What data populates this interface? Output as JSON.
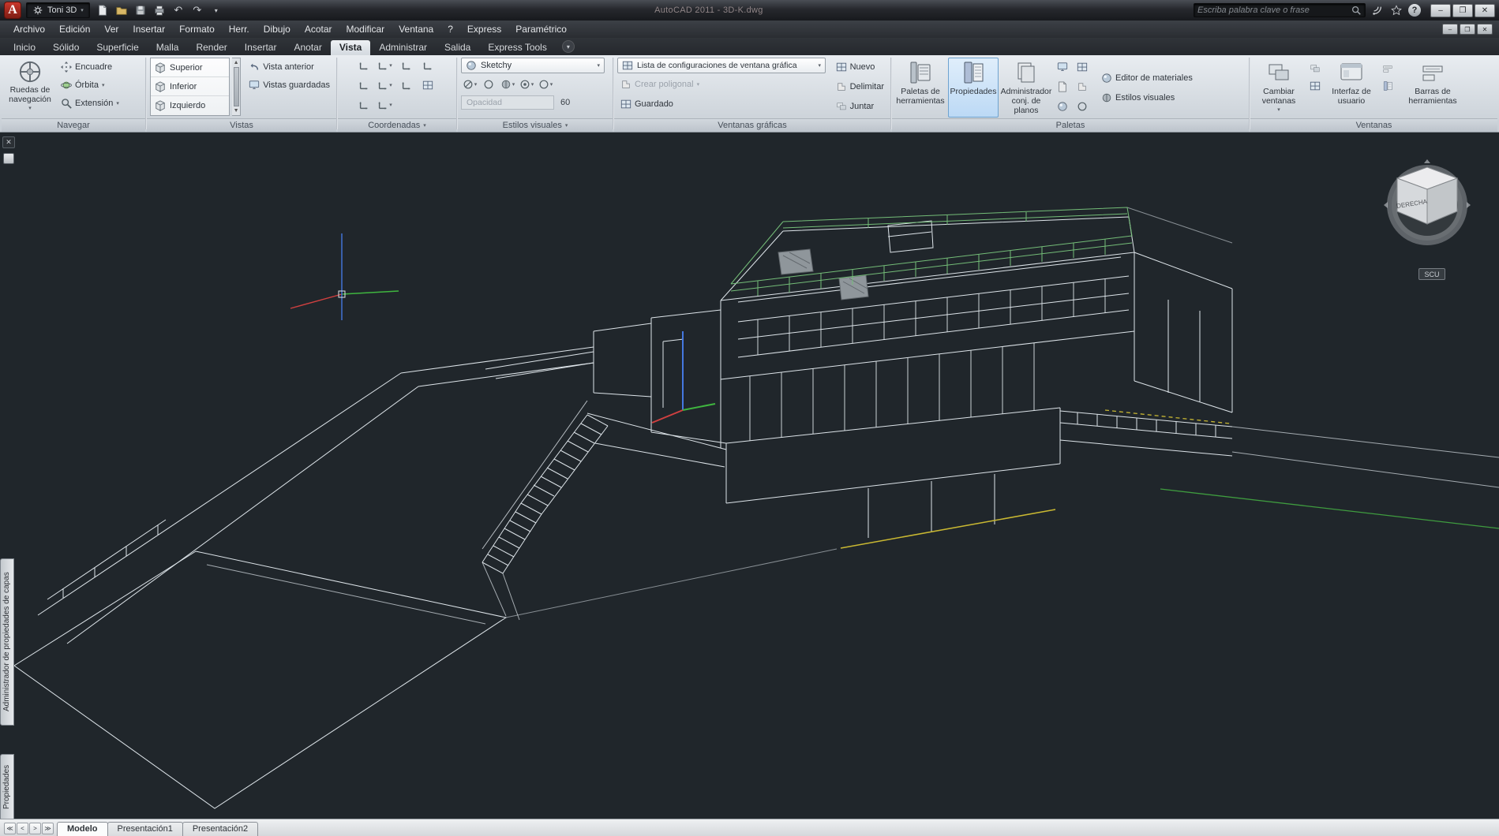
{
  "titlebar": {
    "logo_letter": "A",
    "workspace": "Toni 3D",
    "title": "AutoCAD 2011 - 3D-K.dwg",
    "search_placeholder": "Escriba palabra clave o frase"
  },
  "window": {
    "minimize": "–",
    "restore": "❐",
    "close": "✕"
  },
  "menubar": {
    "items": [
      "Archivo",
      "Edición",
      "Ver",
      "Insertar",
      "Formato",
      "Herr.",
      "Dibujo",
      "Acotar",
      "Modificar",
      "Ventana",
      "?",
      "Express",
      "Paramétrico"
    ]
  },
  "ribbon": {
    "tabs": [
      "Inicio",
      "Sólido",
      "Superficie",
      "Malla",
      "Render",
      "Insertar",
      "Anotar",
      "Vista",
      "Administrar",
      "Salida",
      "Express Tools"
    ],
    "active_tab": "Vista",
    "navegar": {
      "label": "Navegar",
      "wheel": "Ruedas de navegación",
      "encuadre": "Encuadre",
      "orbita": "Órbita",
      "extension": "Extensión"
    },
    "vistas": {
      "label": "Vistas",
      "items": [
        "Superior",
        "Inferior",
        "Izquierdo"
      ],
      "anterior": "Vista anterior",
      "guardadas": "Vistas guardadas"
    },
    "coordenadas": {
      "label": "Coordenadas"
    },
    "estilos": {
      "label": "Estilos visuales",
      "actual": "Sketchy",
      "opacidad": "Opacidad",
      "opacidad_valor": "60"
    },
    "vgraficas": {
      "label": "Ventanas gráficas",
      "lista": "Lista de configuraciones de ventana gráfica",
      "crear": "Crear poligonal",
      "guardado": "Guardado",
      "nuevo": "Nuevo",
      "delimitar": "Delimitar",
      "juntar": "Juntar"
    },
    "paletas": {
      "label": "Paletas",
      "herramientas": "Paletas de herramientas",
      "propiedades": "Propiedades",
      "admin": "Administrador conj. de planos",
      "editor": "Editor de materiales",
      "estilos": "Estilos visuales"
    },
    "ventanas": {
      "label": "Ventanas",
      "cambiar": "Cambiar ventanas",
      "interfaz": "Interfaz de usuario",
      "barras": "Barras de herramientas"
    }
  },
  "viewport": {
    "viewcube_face": "DERECHA",
    "scu_badge": "SCU"
  },
  "side_tabs": {
    "capas": "Administrador de propiedades de capas",
    "propiedades": "Propiedades"
  },
  "statusbar": {
    "tabs": [
      "Modelo",
      "Presentación1",
      "Presentación2"
    ],
    "active_tab": "Modelo"
  },
  "colors": {
    "viewport_bg": "#20262b",
    "wireframe": "#dde4e9",
    "railing_green": "#74bd78",
    "accent_yellow": "#c9b832",
    "axis_red": "#d04040",
    "axis_green": "#3fb53f",
    "axis_blue": "#4478e0",
    "active_button_blue": "#bcd9f5"
  }
}
